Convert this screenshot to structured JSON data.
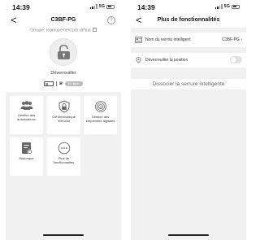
{
  "left": {
    "status": {
      "time": "14:39",
      "network": "5G",
      "battery": "99"
    },
    "nav": {
      "back": "<",
      "title": "C3BF-PG",
      "help": "?"
    },
    "group_label": "Groupe: regroupement par défaut",
    "unlock_label": "Déverrouiller",
    "status_pill": "En ligne",
    "tiles": [
      {
        "label": "Gestion des autorisations",
        "icon": "users-icon"
      },
      {
        "label": "Clé électronique WeChat",
        "icon": "electronic-key-icon"
      },
      {
        "label": "Gestion des empreintes digitales",
        "icon": "fingerprint-icon"
      },
      {
        "label": "Historique",
        "icon": "history-icon"
      },
      {
        "label": "Plus de fonctionnalités",
        "icon": "more-icon"
      }
    ]
  },
  "right": {
    "status": {
      "time": "14:39",
      "network": "5G",
      "battery": "99"
    },
    "nav": {
      "back": "<",
      "title": "Plus de fonctionnalités"
    },
    "lock_name_label": "Nom du verrou intelligent",
    "lock_name_value": "C3BF-PG",
    "position_unlock_label": "Déverrouiller la position",
    "position_unlock_enabled": false,
    "dissociate_label": "Dissocier la serrure intelligente"
  }
}
